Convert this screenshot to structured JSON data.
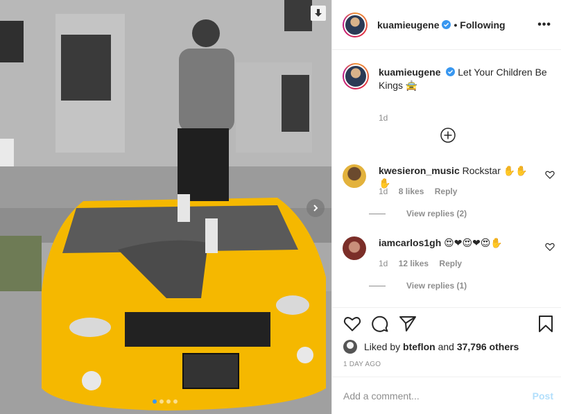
{
  "post": {
    "author": "kuamieugene",
    "follow_status": "Following",
    "more_label": "•••",
    "caption": "Let Your Children Be Kings 🚖",
    "caption_age": "1d",
    "image_slides": 4,
    "active_slide": 1
  },
  "comments": [
    {
      "username": "kwesieron_music",
      "text": "Rockstar ✋✋✋",
      "age": "1d",
      "likes": "8 likes",
      "reply_label": "Reply",
      "view_replies": "View replies (2)"
    },
    {
      "username": "iamcarlos1gh",
      "text": "😍❤😍❤😍✋",
      "age": "1d",
      "likes": "12 likes",
      "reply_label": "Reply",
      "view_replies": "View replies (1)"
    }
  ],
  "likes": {
    "liked_by_prefix": "Liked by",
    "liked_by_user": "bteflon",
    "and_label": "and",
    "others": "37,796 others"
  },
  "timestamp": "1 DAY AGO",
  "add_comment": {
    "placeholder": "Add a comment...",
    "post_label": "Post"
  },
  "icons": {
    "download": "download-icon",
    "next": "chevron-right-icon",
    "load_more": "plus-circle-icon",
    "like": "heart-icon",
    "comment": "comment-icon",
    "share": "paper-plane-icon",
    "save": "bookmark-icon",
    "verified": "verified-badge-icon"
  },
  "colors": {
    "car_yellow": "#f5b800",
    "accent_blue": "#3897f0",
    "post_disabled": "#b2dffc",
    "verified": "#3897f0"
  }
}
